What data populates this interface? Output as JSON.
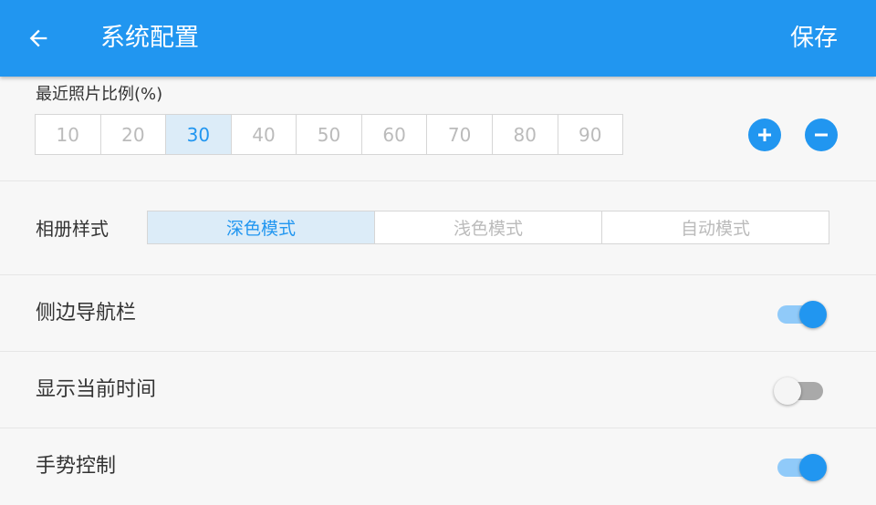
{
  "appbar": {
    "title": "系统配置",
    "save_label": "保存",
    "background": "#2196f0"
  },
  "ratio": {
    "label": "最近照片比例(%)",
    "options": [
      "10",
      "20",
      "30",
      "40",
      "50",
      "60",
      "70",
      "80",
      "90"
    ],
    "selected": "30",
    "increase_icon": "plus-icon",
    "decrease_icon": "minus-icon"
  },
  "album_style": {
    "label": "相册样式",
    "options": [
      "深色模式",
      "浅色模式",
      "自动模式"
    ],
    "selected": "深色模式"
  },
  "toggles": [
    {
      "label": "侧边导航栏",
      "on": true
    },
    {
      "label": "显示当前时间",
      "on": false
    },
    {
      "label": "手势控制",
      "on": true
    }
  ],
  "colors": {
    "accent": "#2196f0",
    "selected_segment_bg": "#dcecf8",
    "switch_on_track": "#90caf9",
    "switch_off_track": "#a9a9a9"
  }
}
